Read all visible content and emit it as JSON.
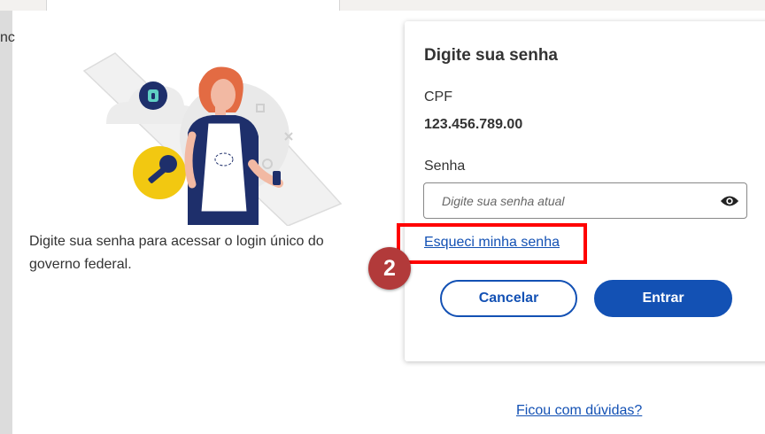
{
  "background": {
    "peek_text": "nc"
  },
  "intro": {
    "text": "Digite sua senha para acessar o login único do governo federal."
  },
  "card": {
    "title": "Digite sua senha",
    "cpf_label": "CPF",
    "cpf_value": "123.456.789.00",
    "password_label": "Senha",
    "password_placeholder": "Digite sua senha atual",
    "password_value": "",
    "forgot_link": "Esqueci minha senha",
    "cancel_label": "Cancelar",
    "submit_label": "Entrar"
  },
  "annotation": {
    "step_number": "2"
  },
  "help_link": "Ficou com dúvidas?",
  "icons": {
    "show_password": "eye-icon",
    "illustration": "woman-with-phone-illustration",
    "key": "key-icon",
    "lock": "lock-icon"
  },
  "colors": {
    "primary": "#1351b4",
    "highlight": "#ff0000",
    "badge": "#b23a3a",
    "key_badge": "#f2c811"
  }
}
